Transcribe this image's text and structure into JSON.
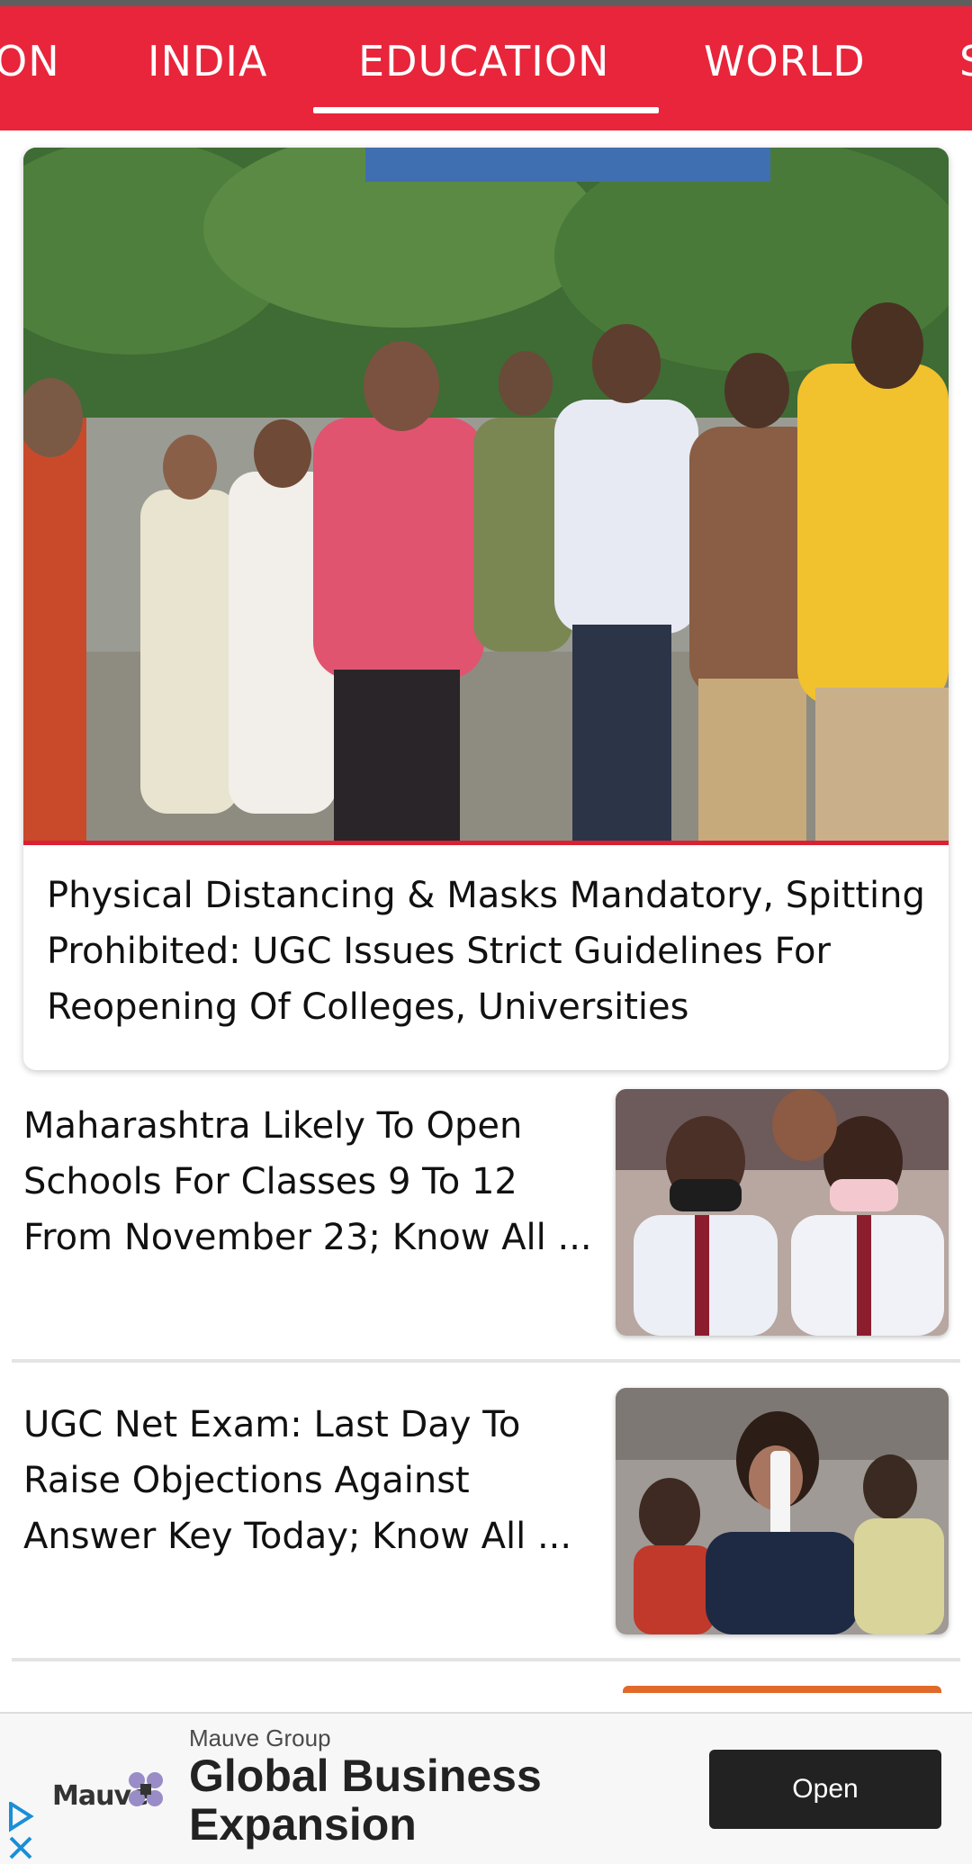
{
  "tabs": [
    {
      "label": "ON",
      "selected": false
    },
    {
      "label": "INDIA",
      "selected": false
    },
    {
      "label": "EDUCATION",
      "selected": true
    },
    {
      "label": "WORLD",
      "selected": false
    },
    {
      "label": "S",
      "selected": false
    }
  ],
  "colors": {
    "accent_red": "#e8253a",
    "tab_text": "#ffffff",
    "ad_button": "#222222"
  },
  "featured": {
    "image_icon": "students-queue-photo",
    "title": "Physical Distancing & Masks Mandatory, Spitting Prohibited: UGC Issues Strict Guidelines For Reopening Of Colleges, Universities"
  },
  "stories": [
    {
      "title": "Maharashtra Likely To Open Schools For Classes 9 To 12 From November 23; Know All ...",
      "image_icon": "schoolgirls-masks-photo"
    },
    {
      "title": " UGC Net Exam: Last Day To Raise Objections Against Answer Key Today; Know All ...",
      "image_icon": "student-exam-paper-photo"
    }
  ],
  "ad": {
    "sponsor": "Mauve Group",
    "headline": "Global Business Expansion",
    "button_label": "Open",
    "logo_text": "Mauve",
    "choices_icon": "adchoices-icon",
    "close_icon": "close-icon"
  }
}
